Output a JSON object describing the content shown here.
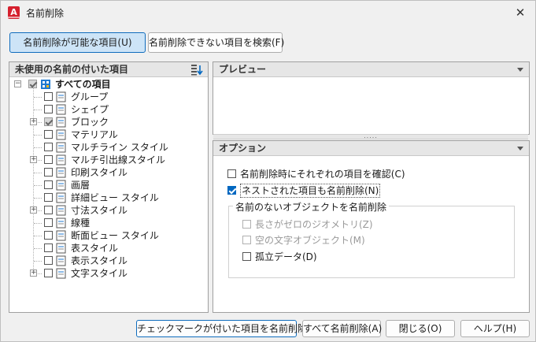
{
  "window": {
    "title": "名前削除",
    "app_icon_letter": "A"
  },
  "top_buttons": {
    "purgeable_label": "名前削除が可能な項目(U)",
    "non_purgeable_label": "名前削除できない項目を検索(F)"
  },
  "tree_panel": {
    "title": "未使用の名前の付いた項目",
    "root_label": "すべての項目",
    "items": [
      {
        "label": "グループ",
        "icon": "group-icon",
        "expandable": false,
        "checked": false
      },
      {
        "label": "シェイプ",
        "icon": "shape-icon",
        "expandable": false,
        "checked": false
      },
      {
        "label": "ブロック",
        "icon": "block-icon",
        "expandable": true,
        "checked": true
      },
      {
        "label": "マテリアル",
        "icon": "material-icon",
        "expandable": false,
        "checked": false
      },
      {
        "label": "マルチライン スタイル",
        "icon": "multiline-style-icon",
        "expandable": false,
        "checked": false
      },
      {
        "label": "マルチ引出線スタイル",
        "icon": "multileader-style-icon",
        "expandable": true,
        "checked": false
      },
      {
        "label": "印刷スタイル",
        "icon": "plot-style-icon",
        "expandable": false,
        "checked": false
      },
      {
        "label": "画層",
        "icon": "layer-icon",
        "expandable": false,
        "checked": false
      },
      {
        "label": "詳細ビュー スタイル",
        "icon": "detail-view-style-icon",
        "expandable": false,
        "checked": false
      },
      {
        "label": "寸法スタイル",
        "icon": "dimension-style-icon",
        "expandable": true,
        "checked": false
      },
      {
        "label": "線種",
        "icon": "linetype-icon",
        "expandable": false,
        "checked": false
      },
      {
        "label": "断面ビュー スタイル",
        "icon": "section-view-style-icon",
        "expandable": false,
        "checked": false
      },
      {
        "label": "表スタイル",
        "icon": "table-style-icon",
        "expandable": false,
        "checked": false
      },
      {
        "label": "表示スタイル",
        "icon": "visual-style-icon",
        "expandable": false,
        "checked": false
      },
      {
        "label": "文字スタイル",
        "icon": "text-style-icon",
        "expandable": true,
        "checked": false
      }
    ]
  },
  "preview_panel": {
    "title": "プレビュー"
  },
  "options_panel": {
    "title": "オプション",
    "confirm_each": {
      "label": "名前削除時にそれぞれの項目を確認(C)",
      "checked": false
    },
    "nested": {
      "label": "ネストされた項目も名前削除(N)",
      "checked": true
    },
    "unnamed_group": {
      "title": "名前のないオブジェクトを名前削除",
      "zero_length": {
        "label": "長さがゼロのジオメトリ(Z)",
        "checked": false,
        "enabled": false
      },
      "empty_text": {
        "label": "空の文字オブジェクト(M)",
        "checked": false,
        "enabled": false
      },
      "orphaned_data": {
        "label": "孤立データ(D)",
        "checked": false,
        "enabled": true
      }
    }
  },
  "bottom_buttons": {
    "purge_checked": "チェックマークが付いた項目を名前削除(P)",
    "purge_all": "すべて名前削除(A)",
    "close": "閉じる(O)",
    "help": "ヘルプ(H)"
  },
  "colors": {
    "accent": "#0067c0",
    "active_tab": "#cde4f7",
    "app_icon": "#d5202e"
  }
}
